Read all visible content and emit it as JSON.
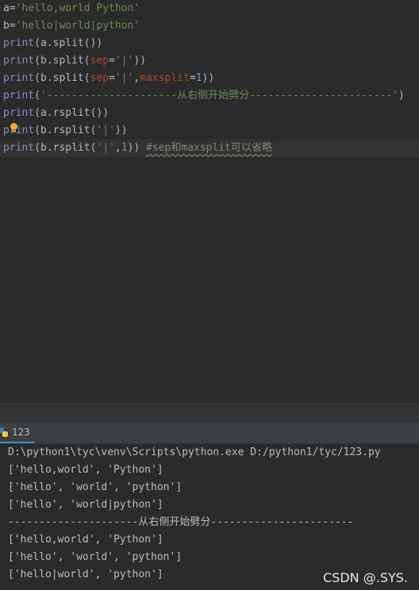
{
  "editor": {
    "line1": {
      "pre": "a=",
      "str": "'hello,world Python'"
    },
    "line2": {
      "pre": "b=",
      "str": "'hello|world|python'"
    },
    "line3": {
      "fn": "print",
      "rest": "(a.split())"
    },
    "line4": {
      "fn": "print",
      "a": "(b.split(",
      "kw": "sep",
      "b": "=",
      "str": "'|'",
      "c": "))"
    },
    "line5": {
      "fn": "print",
      "a": "(b.split(",
      "kw1": "sep",
      "b": "=",
      "str": "'|'",
      "c": ",",
      "kw2": "maxsplit",
      "d": "=",
      "num": "1",
      "e": "))"
    },
    "line6": {
      "fn": "print",
      "a": "(",
      "str": "'---------------------从右侧开始劈分-----------------------'",
      "b": ")"
    },
    "line7": {
      "fn": "print",
      "rest": "(a.rsplit())"
    },
    "line8": {
      "fn": "print",
      "a": "(b.rsplit(",
      "str": "'|'",
      "b": "))"
    },
    "line9": {
      "fn": "print",
      "a": "(b.rsplit(",
      "str": "'|'",
      "b": ",",
      "num": "1",
      "c": "))",
      "comment": "#sep和maxsplit可以省略"
    }
  },
  "run_panel": {
    "tab_label": "123",
    "output": [
      "D:\\python1\\tyc\\venv\\Scripts\\python.exe D:/python1/tyc/123.py",
      "['hello,world', 'Python']",
      "['hello', 'world', 'python']",
      "['hello', 'world|python']",
      "---------------------从右侧开始劈分-----------------------",
      "['hello,world', 'Python']",
      "['hello', 'world', 'python']",
      "['hello|world', 'python']"
    ]
  },
  "watermark": "CSDN @.SYS.",
  "colors": {
    "background": "#2b2b2b",
    "string": "#6a8759",
    "keyword_arg": "#aa4926",
    "builtin": "#8888c6",
    "number": "#6897bb"
  },
  "icons": {
    "bulb": "lightbulb-icon",
    "run_tab": "python-file-icon"
  }
}
